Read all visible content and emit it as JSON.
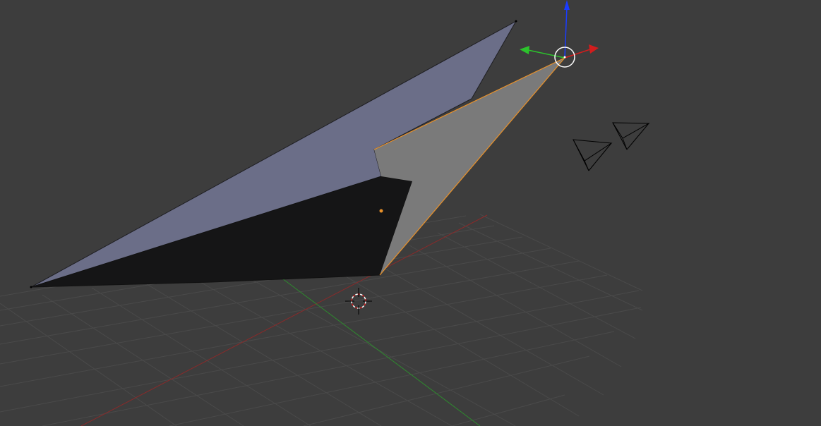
{
  "viewport": {
    "background": "#3d3d3d",
    "grid_color": "#4a4a4a",
    "x_axis_color": "#8a2a2a",
    "y_axis_color": "#2e8a2e"
  },
  "mesh": {
    "face_light_color": "#6b6e88",
    "face_dark_color": "#151516",
    "face_selected_color": "#7a7a7a",
    "selection_color": "#e8912a"
  },
  "gizmo": {
    "x_color": "#d11d1d",
    "y_color": "#2cc22c",
    "z_color": "#1a3cff",
    "center_color": "#ffffff"
  },
  "icons": {
    "cursor": "3d-cursor-icon",
    "lamp": "lamp-icon",
    "camera": "camera-icon"
  }
}
